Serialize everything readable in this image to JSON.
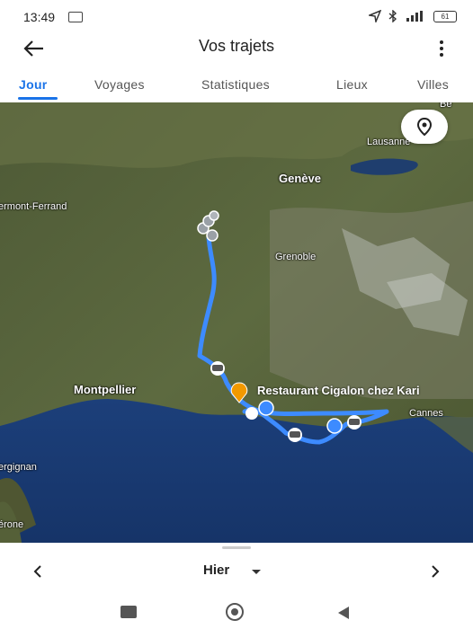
{
  "status": {
    "time": "13:49",
    "battery": "61"
  },
  "header": {
    "title": "Vos trajets"
  },
  "tabs": [
    {
      "label": "Jour"
    },
    {
      "label": "Voyages"
    },
    {
      "label": "Statistiques"
    },
    {
      "label": "Lieux"
    },
    {
      "label": "Villes"
    }
  ],
  "map": {
    "labels": {
      "be": "Be",
      "lausanne": "Lausanne",
      "geneve": "Genève",
      "clermont": "ermont-Ferrand",
      "grenoble": "Grenoble",
      "montpellier": "Montpellier",
      "cannes": "Cannes",
      "perpignan": "ergignan",
      "gerone": "érone"
    },
    "poi": "Restaurant Cigalon chez Kari"
  },
  "bottom": {
    "day": "Hier"
  },
  "colors": {
    "accent": "#1a73e8",
    "route": "#3d8bff",
    "poi": "#f29900"
  }
}
